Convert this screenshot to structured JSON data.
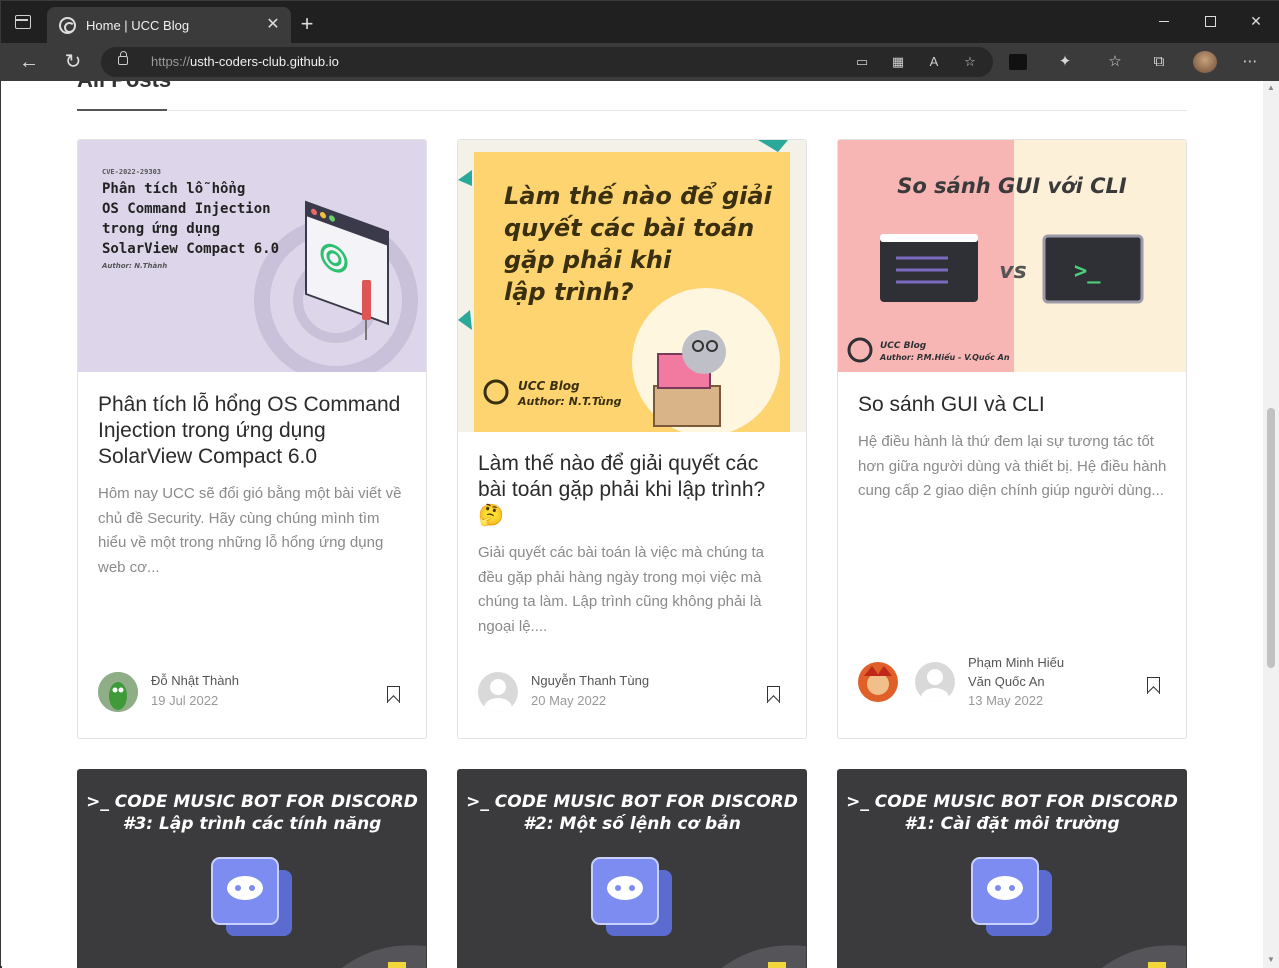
{
  "browser": {
    "tab_title": "Home | UCC Blog",
    "url_scheme": "https://",
    "url_host": "usth-coders-club.github.io",
    "tab_close": "✕",
    "new_tab": "+"
  },
  "section": {
    "title": "All Posts"
  },
  "posts": [
    {
      "title": "Phân tích lỗ hổng OS Command Injection trong ứng dụng SolarView Compact 6.0",
      "excerpt": "Hôm nay UCC sẽ đổi gió bằng một bài viết về chủ đề Security. Hãy cùng chúng mình tìm hiểu về một trong những lỗ hổng ứng dụng web cơ...",
      "authors": [
        "Đỗ Nhật Thành"
      ],
      "date": "19 Jul 2022",
      "thumb": {
        "cve": "CVE-2022-29303",
        "lines": [
          "Phân tích lỗ hổng",
          "OS Command Injection",
          "trong ứng dụng",
          "SolarView Compact 6.0"
        ],
        "author": "Author: N.Thành"
      }
    },
    {
      "title": "Làm thế nào để giải quyết các bài toán gặp phải khi lập trình? 🤔",
      "excerpt": "Giải quyết các bài toán là việc mà chúng ta đều gặp phải hàng ngày trong mọi việc mà chúng ta làm. Lập trình cũng không phải là ngoại lệ....",
      "authors": [
        "Nguyễn Thanh Tùng"
      ],
      "date": "20 May 2022",
      "thumb": {
        "lines": [
          "Làm thế nào để giải",
          "quyết các bài toán",
          "gặp phải khi",
          "lập trình?"
        ],
        "brand": "UCC Blog",
        "author": "Author: N.T.Tùng"
      }
    },
    {
      "title": "So sánh GUI và CLI",
      "excerpt": "Hệ điều hành là thứ đem lại sự tương tác tốt hơn giữa người dùng và thiết bị. Hệ điều hành cung cấp 2 giao diện chính giúp người dùng...",
      "authors": [
        "Phạm Minh Hiếu",
        "Văn Quốc An"
      ],
      "date": "13 May 2022",
      "thumb": {
        "heading": "So sánh GUI với CLI",
        "vs": "vs",
        "prompt": ">_",
        "brand": "UCC Blog",
        "author": "Author: P.M.Hiếu - V.Quốc An"
      }
    }
  ],
  "discord_posts": [
    {
      "line1": ">_ CODE MUSIC BOT FOR DISCORD",
      "line2": "#3: Lập trình các tính năng"
    },
    {
      "line1": ">_ CODE MUSIC BOT FOR DISCORD",
      "line2": "#2: Một số lệnh cơ bản"
    },
    {
      "line1": ">_ CODE MUSIC BOT FOR DISCORD",
      "line2": "#1: Cài đặt môi trường"
    }
  ],
  "colors": {
    "thumb1_bg": "#ddd6ea",
    "thumb2_bg": "#fdd46f",
    "thumb3_left": "#f7b6b4",
    "thumb3_right": "#fdf0d8",
    "discord_bg": "#3b3a3c",
    "discord_blurple": "#7c8cf0"
  }
}
